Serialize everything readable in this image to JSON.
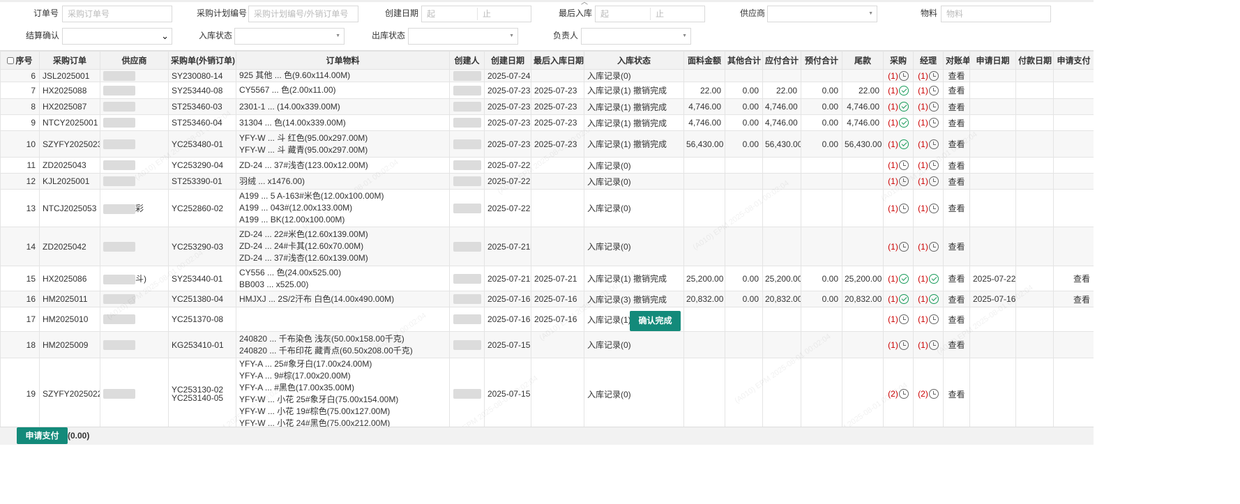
{
  "filters": {
    "order_no": {
      "label": "订单号",
      "placeholder": "采购订单号"
    },
    "plan_no": {
      "label": "采购计划编号",
      "placeholder": "采购计划编号/外销订单号"
    },
    "create_date": {
      "label": "创建日期",
      "from": "起",
      "to": "止"
    },
    "last_in": {
      "label": "最后入库",
      "from": "起",
      "to": "止"
    },
    "supplier": {
      "label": "供应商"
    },
    "material": {
      "label": "物料",
      "placeholder": "物料"
    },
    "settle": {
      "label": "结算确认"
    },
    "in_status": {
      "label": "入库状态"
    },
    "out_status": {
      "label": "出库状态"
    },
    "owner": {
      "label": "负责人"
    }
  },
  "table": {
    "headers": [
      "序号",
      "采购订单",
      "供应商",
      "采购单(外销订单)",
      "订单物料",
      "创建人",
      "创建日期",
      "最后入库日期",
      "入库状态",
      "面料金额",
      "其他合计",
      "应付合计",
      "预付合计",
      "尾款",
      "采购",
      "经理",
      "对账单",
      "申请日期",
      "付款日期",
      "申请支付"
    ],
    "rows": [
      {
        "seq": "6",
        "order": "JSL2025001",
        "supplier": "",
        "po": "SY230080-14",
        "materials": [
          "925 其他 ... 色(9.60x114.00M)"
        ],
        "creator": "",
        "created": "2025-07-24",
        "last_in": "",
        "status": "入库记录(0)",
        "fabric": "",
        "other": "",
        "payable": "",
        "prepaid": "",
        "balance": "",
        "buy_cnt": "(1)",
        "buy_icon": "clock",
        "mgr_cnt": "(1)",
        "mgr_icon": "clock",
        "stmt": "查看",
        "apply_date": "",
        "pay_date": "",
        "apply_pay": ""
      },
      {
        "seq": "7",
        "order": "HX2025088",
        "supplier": "",
        "po": "SY253440-08",
        "materials": [
          "CY5567 ... 色(2.00x11.00)"
        ],
        "creator": "",
        "created": "2025-07-23",
        "last_in": "2025-07-23",
        "status": "入库记录(1) 撤销完成",
        "fabric": "22.00",
        "other": "0.00",
        "payable": "22.00",
        "prepaid": "0.00",
        "balance": "22.00",
        "buy_cnt": "(1)",
        "buy_icon": "check",
        "mgr_cnt": "(1)",
        "mgr_icon": "clock",
        "stmt": "查看",
        "apply_date": "",
        "pay_date": "",
        "apply_pay": ""
      },
      {
        "seq": "8",
        "order": "HX2025087",
        "supplier": "",
        "po": "ST253460-03",
        "materials": [
          "2301-1 ... (14.00x339.00M)"
        ],
        "creator": "",
        "created": "2025-07-23",
        "last_in": "2025-07-23",
        "status": "入库记录(1) 撤销完成",
        "fabric": "4,746.00",
        "other": "0.00",
        "payable": "4,746.00",
        "prepaid": "0.00",
        "balance": "4,746.00",
        "buy_cnt": "(1)",
        "buy_icon": "check",
        "mgr_cnt": "(1)",
        "mgr_icon": "clock",
        "stmt": "查看",
        "apply_date": "",
        "pay_date": "",
        "apply_pay": ""
      },
      {
        "seq": "9",
        "order": "NTCY2025001",
        "supplier": "",
        "po": "ST253460-04",
        "materials": [
          "31304 ... 色(14.00x339.00M)"
        ],
        "creator": "",
        "created": "2025-07-23",
        "last_in": "2025-07-23",
        "status": "入库记录(1) 撤销完成",
        "fabric": "4,746.00",
        "other": "0.00",
        "payable": "4,746.00",
        "prepaid": "0.00",
        "balance": "4,746.00",
        "buy_cnt": "(1)",
        "buy_icon": "check",
        "mgr_cnt": "(1)",
        "mgr_icon": "clock",
        "stmt": "查看",
        "apply_date": "",
        "pay_date": "",
        "apply_pay": ""
      },
      {
        "seq": "10",
        "order": "SZYFY2025023",
        "supplier": "",
        "po": "YC253480-01",
        "materials": [
          "YFY-W ... 斗 红色(95.00x297.00M)",
          "YFY-W ... 斗 藏青(95.00x297.00M)"
        ],
        "creator": "",
        "created": "2025-07-23",
        "last_in": "2025-07-23",
        "status": "入库记录(1) 撤销完成",
        "fabric": "56,430.00",
        "other": "0.00",
        "payable": "56,430.00",
        "prepaid": "0.00",
        "balance": "56,430.00",
        "buy_cnt": "(1)",
        "buy_icon": "check",
        "mgr_cnt": "(1)",
        "mgr_icon": "clock",
        "stmt": "查看",
        "apply_date": "",
        "pay_date": "",
        "apply_pay": ""
      },
      {
        "seq": "11",
        "order": "ZD2025043",
        "supplier": "",
        "po": "YC253290-04",
        "materials": [
          "ZD-24 ... 37#浅杏(123.00x12.00M)"
        ],
        "creator": "",
        "created": "2025-07-22",
        "last_in": "",
        "status": "入库记录(0)",
        "fabric": "",
        "other": "",
        "payable": "",
        "prepaid": "",
        "balance": "",
        "buy_cnt": "(1)",
        "buy_icon": "clock",
        "mgr_cnt": "(1)",
        "mgr_icon": "clock",
        "stmt": "查看",
        "apply_date": "",
        "pay_date": "",
        "apply_pay": ""
      },
      {
        "seq": "12",
        "order": "KJL2025001",
        "supplier": "",
        "po": "ST253390-01",
        "materials": [
          "羽绒 ... x1476.00)"
        ],
        "creator": "",
        "created": "2025-07-22",
        "last_in": "",
        "status": "入库记录(0)",
        "fabric": "",
        "other": "",
        "payable": "",
        "prepaid": "",
        "balance": "",
        "buy_cnt": "(1)",
        "buy_icon": "clock",
        "mgr_cnt": "(1)",
        "mgr_icon": "clock",
        "stmt": "查看",
        "apply_date": "",
        "pay_date": "",
        "apply_pay": ""
      },
      {
        "seq": "13",
        "order": "NTCJ2025053",
        "supplier": "彩",
        "po": "YC252860-02",
        "materials": [
          "A199 ... 5 A-163#米色(12.00x100.00M)",
          "A199 ... 043#(12.00x133.00M)",
          "A199 ... BK(12.00x100.00M)"
        ],
        "creator": "",
        "created": "2025-07-22",
        "last_in": "",
        "status": "入库记录(0)",
        "fabric": "",
        "other": "",
        "payable": "",
        "prepaid": "",
        "balance": "",
        "buy_cnt": "(1)",
        "buy_icon": "clock",
        "mgr_cnt": "(1)",
        "mgr_icon": "clock",
        "stmt": "查看",
        "apply_date": "",
        "pay_date": "",
        "apply_pay": ""
      },
      {
        "seq": "14",
        "order": "ZD2025042",
        "supplier": "",
        "po": "YC253290-03",
        "materials": [
          "ZD-24 ... 22#米色(12.60x139.00M)",
          "ZD-24 ... 24#卡其(12.60x70.00M)",
          "ZD-24 ... 37#浅杏(12.60x139.00M)"
        ],
        "creator": "",
        "created": "2025-07-21",
        "last_in": "",
        "status": "入库记录(0)",
        "fabric": "",
        "other": "",
        "payable": "",
        "prepaid": "",
        "balance": "",
        "buy_cnt": "(1)",
        "buy_icon": "clock",
        "mgr_cnt": "(1)",
        "mgr_icon": "clock",
        "stmt": "查看",
        "apply_date": "",
        "pay_date": "",
        "apply_pay": ""
      },
      {
        "seq": "15",
        "order": "HX2025086",
        "supplier": "斗)",
        "po": "SY253440-01",
        "materials": [
          "CY556 ... 色(24.00x525.00)",
          "BB003 ... x525.00)"
        ],
        "creator": "",
        "created": "2025-07-21",
        "last_in": "2025-07-21",
        "status": "入库记录(1) 撤销完成",
        "fabric": "25,200.00",
        "other": "0.00",
        "payable": "25,200.00",
        "prepaid": "0.00",
        "balance": "25,200.00",
        "buy_cnt": "(1)",
        "buy_icon": "check",
        "mgr_cnt": "(1)",
        "mgr_icon": "check",
        "stmt": "查看",
        "apply_date": "2025-07-22",
        "pay_date": "",
        "apply_pay": "查看"
      },
      {
        "seq": "16",
        "order": "HM2025011",
        "supplier": "",
        "po": "YC251380-04",
        "materials": [
          "HMJXJ ... 2S/2汗布 白色(14.00x490.00M)"
        ],
        "creator": "",
        "created": "2025-07-16",
        "last_in": "2025-07-16",
        "status": "入库记录(3) 撤销完成",
        "fabric": "20,832.00",
        "other": "0.00",
        "payable": "20,832.00",
        "prepaid": "0.00",
        "balance": "20,832.00",
        "buy_cnt": "(1)",
        "buy_icon": "check",
        "mgr_cnt": "(1)",
        "mgr_icon": "check",
        "stmt": "查看",
        "apply_date": "2025-07-16",
        "pay_date": "",
        "apply_pay": "查看"
      },
      {
        "seq": "17",
        "order": "HM2025010",
        "supplier": "",
        "po": "YC251370-08",
        "materials": [
          ""
        ],
        "creator": "",
        "created": "2025-07-16",
        "last_in": "2025-07-16",
        "status": "入库记录(1)",
        "fabric": "",
        "other": "",
        "payable": "",
        "prepaid": "",
        "balance": "",
        "buy_cnt": "(1)",
        "buy_icon": "clock",
        "mgr_cnt": "(1)",
        "mgr_icon": "clock",
        "stmt": "查看",
        "apply_date": "",
        "pay_date": "",
        "apply_pay": ""
      },
      {
        "seq": "18",
        "order": "HM2025009",
        "supplier": "",
        "po": "KG253410-01",
        "materials": [
          "240820 ... 千布染色 浅灰(50.00x158.00千克)",
          "240820 ... 千布印花 藏青点(60.50x208.00千克)"
        ],
        "creator": "",
        "created": "2025-07-15",
        "last_in": "",
        "status": "入库记录(0)",
        "fabric": "",
        "other": "",
        "payable": "",
        "prepaid": "",
        "balance": "",
        "buy_cnt": "(1)",
        "buy_icon": "clock",
        "mgr_cnt": "(1)",
        "mgr_icon": "clock",
        "stmt": "查看",
        "apply_date": "",
        "pay_date": "",
        "apply_pay": ""
      },
      {
        "seq": "19",
        "order": "SZYFY2025022",
        "supplier": "",
        "po": "YC253130-02\nYC253140-05",
        "materials": [
          "YFY-A ... 25#象牙白(17.00x24.00M)",
          "YFY-A ... 9#棕(17.00x20.00M)",
          "YFY-A ... #黑色(17.00x35.00M)",
          "YFY-W ... 小花 25#象牙白(75.00x154.00M)",
          "YFY-W ... 小花 19#棕色(75.00x127.00M)",
          "YFY-W ... 小花 24#黑色(75.00x212.00M)"
        ],
        "creator": "",
        "created": "2025-07-15",
        "last_in": "",
        "status": "入库记录(0)",
        "fabric": "",
        "other": "",
        "payable": "",
        "prepaid": "",
        "balance": "",
        "buy_cnt": "(2)",
        "buy_icon": "clock",
        "mgr_cnt": "(2)",
        "mgr_icon": "clock",
        "stmt": "查看",
        "apply_date": "",
        "pay_date": "",
        "apply_pay": ""
      }
    ]
  },
  "confirm_button": "确认完成",
  "footer": {
    "apply_button": "申请支付",
    "total": "(0.00)"
  },
  "watermark": "(A010) EPM 2025-08-01 00:02:04",
  "colors": {
    "primary": "#138a7a",
    "check": "#1a9c5b",
    "count": "#cc0000"
  }
}
